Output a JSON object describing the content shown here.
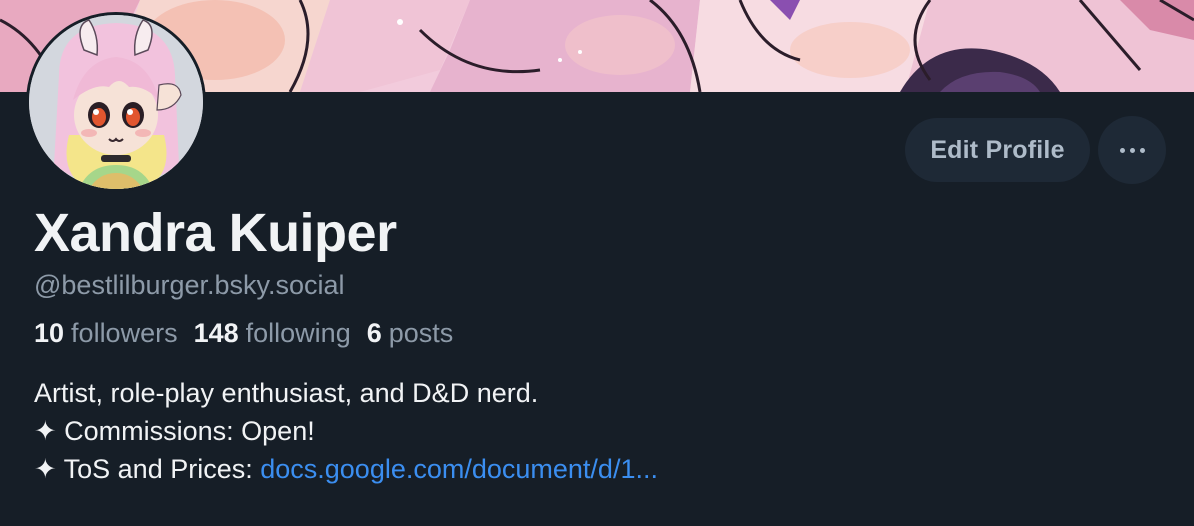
{
  "profile": {
    "display_name": "Xandra Kuiper",
    "handle": "@bestlilburger.bsky.social",
    "stats": {
      "followers_count": "10",
      "followers_label": "followers",
      "following_count": "148",
      "following_label": "following",
      "posts_count": "6",
      "posts_label": "posts"
    },
    "bio": {
      "line1": "Artist, role-play enthusiast, and D&D nerd.",
      "line2": "✦ Commissions: Open!",
      "line3_prefix": "✦ ToS and Prices: ",
      "line3_link": "docs.google.com/document/d/1..."
    }
  },
  "actions": {
    "edit_profile_label": "Edit Profile",
    "more_icon": "ellipsis-icon"
  },
  "colors": {
    "background": "#161e27",
    "button_bg": "#1e2936",
    "link": "#3b8ef0",
    "muted_text": "#8d9aa8",
    "primary_text": "#f1f3f5"
  }
}
